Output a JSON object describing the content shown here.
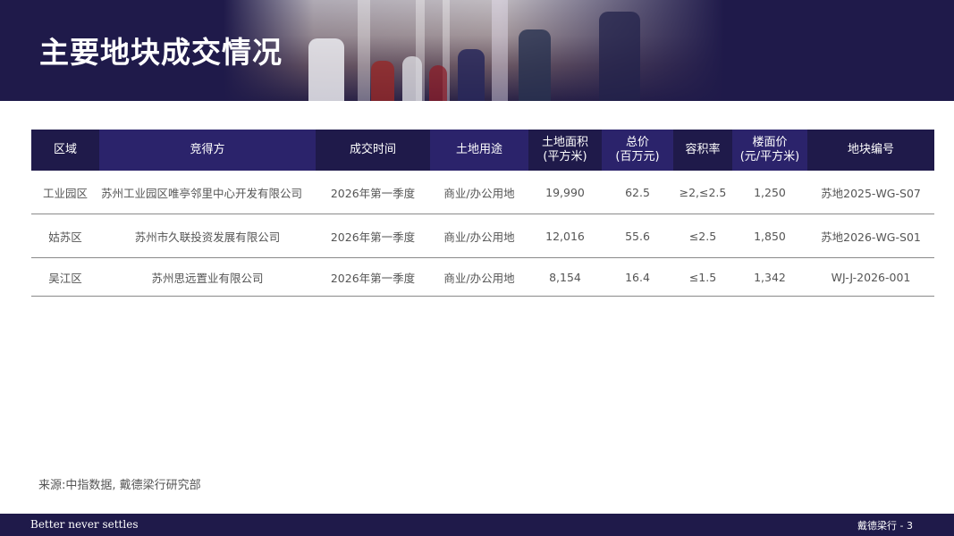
{
  "header": {
    "title": "主要地块成交情况"
  },
  "table": {
    "columns": [
      {
        "label": "区域",
        "sub": ""
      },
      {
        "label": "竞得方",
        "sub": ""
      },
      {
        "label": "成交时间",
        "sub": ""
      },
      {
        "label": "土地用途",
        "sub": ""
      },
      {
        "label": "土地面积",
        "sub": "(平方米)"
      },
      {
        "label": "总价",
        "sub": "(百万元)"
      },
      {
        "label": "容积率",
        "sub": ""
      },
      {
        "label": "楼面价",
        "sub": "(元/平方米)"
      },
      {
        "label": "地块编号",
        "sub": ""
      }
    ],
    "rows": [
      [
        "工业园区",
        "苏州工业园区唯亭邻里中心开发有限公司",
        "2026年第一季度",
        "商业/办公用地",
        "19,990",
        "62.5",
        "≥2,≤2.5",
        "1,250",
        "苏地2025-WG-S07"
      ],
      [
        "姑苏区",
        "苏州市久联投资发展有限公司",
        "2026年第一季度",
        "商业/办公用地",
        "12,016",
        "55.6",
        "≤2.5",
        "1,850",
        "苏地2026-WG-S01"
      ],
      [
        "吴江区",
        "苏州思远置业有限公司",
        "2026年第一季度",
        "商业/办公用地",
        "8,154",
        "16.4",
        "≤1.5",
        "1,342",
        "WJ-J-2026-001"
      ]
    ]
  },
  "source": "来源:中指数据, 戴德梁行研究部",
  "footer": {
    "slogan": "Better never settles",
    "brand_page": "戴德梁行 - 3"
  },
  "colors": {
    "brand_navy": "#1f1a4a",
    "header_alt": "#2b236b",
    "text_gray": "#555555"
  }
}
